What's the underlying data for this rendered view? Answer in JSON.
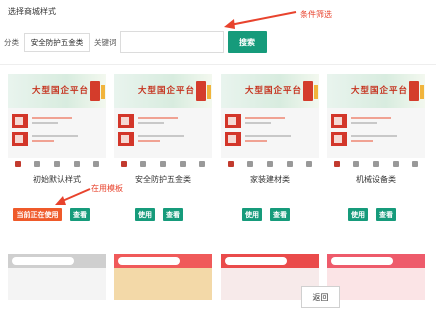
{
  "page": {
    "title": "选择商城样式"
  },
  "annotations": {
    "filter": "条件筛选",
    "in_use": "在用模板"
  },
  "filter": {
    "category_label": "分类",
    "category_value": "安全防护五金类",
    "keyword_label": "关键词",
    "keyword_value": "",
    "search_label": "搜索"
  },
  "templates": [
    {
      "name": "初始默认样式",
      "primary_label": "当前正在使用",
      "view_label": "查看",
      "in_use": true
    },
    {
      "name": "安全防护五金类",
      "primary_label": "使用",
      "view_label": "查看",
      "in_use": false
    },
    {
      "name": "家装建材类",
      "primary_label": "使用",
      "view_label": "查看",
      "in_use": false
    },
    {
      "name": "机械设备类",
      "primary_label": "使用",
      "view_label": "查看",
      "in_use": false
    }
  ],
  "banner_text": "大型国企平台",
  "footer": {
    "back_label": "返回"
  },
  "colors": {
    "accent": "#169b7b",
    "in_use": "#ef5a2a",
    "annotation": "#e8432d",
    "banner_text": "#c5321e"
  }
}
